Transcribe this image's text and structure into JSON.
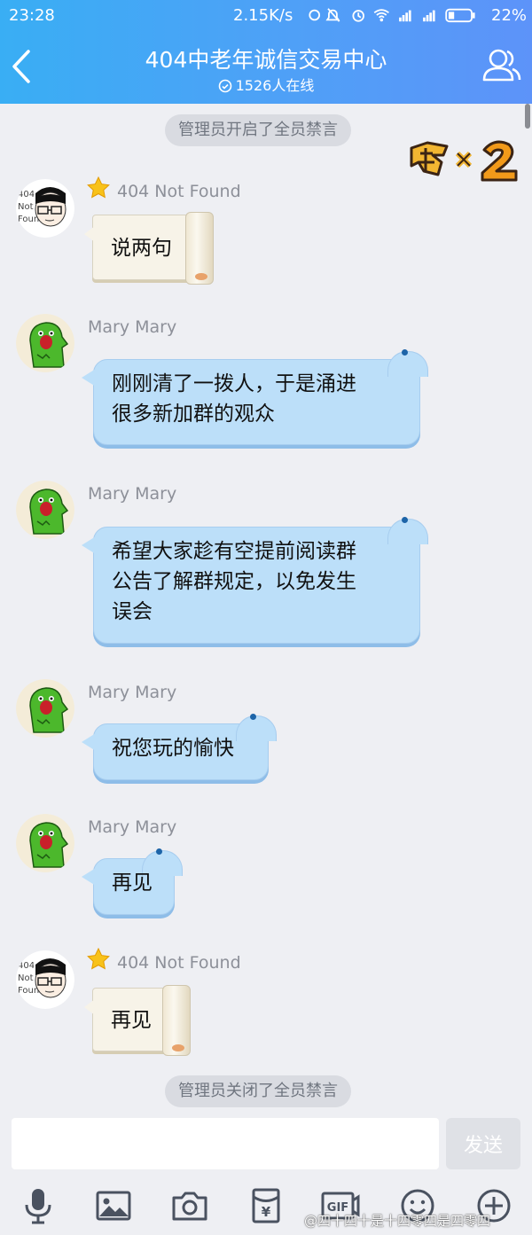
{
  "status_bar": {
    "time": "23:28",
    "net_speed": "2.15K/s",
    "battery": "22%",
    "icons": [
      "sync-icon",
      "mute-icon",
      "alarm-icon",
      "wifi-icon",
      "signal-icon",
      "signal-icon",
      "battery-icon"
    ]
  },
  "header": {
    "title": "404中老年诚信交易中心",
    "online": "1526人在线",
    "back_icon": "chevron-left-icon",
    "members_icon": "members-icon",
    "color_start": "#39aef4",
    "color_end": "#5d93f9"
  },
  "system_messages": {
    "mute_on": "管理员开启了全员禁言",
    "mute_off": "管理员关闭了全员禁言"
  },
  "messages": [
    {
      "sender": "404 Not Found",
      "text": "说两句",
      "bubble": "scroll",
      "badge": "star-icon"
    },
    {
      "sender": "Mary Mary",
      "text": "刚刚清了一拨人，于是涌进\n很多新加群的观众",
      "bubble": "whale"
    },
    {
      "sender": "Mary Mary",
      "text": "希望大家趁有空提前阅读群\n公告了解群规定，以免发生\n误会",
      "bubble": "whale"
    },
    {
      "sender": "Mary Mary",
      "text": "祝您玩的愉快",
      "bubble": "whale"
    },
    {
      "sender": "Mary Mary",
      "text": "再见",
      "bubble": "whale"
    },
    {
      "sender": "404 Not Found",
      "text": "再见",
      "bubble": "scroll",
      "badge": "star-icon"
    }
  ],
  "avatar_404_text": "404\nNot\nFound",
  "composer": {
    "input_value": "",
    "send_label": "发送",
    "toolbar": [
      "microphone-icon",
      "image-icon",
      "camera-icon",
      "red-packet-icon",
      "gif-icon",
      "emoji-icon",
      "plus-icon"
    ],
    "gif_label": "GIF",
    "yen_label": "¥"
  },
  "watermark": "@四十四十是十四零四是四零四"
}
